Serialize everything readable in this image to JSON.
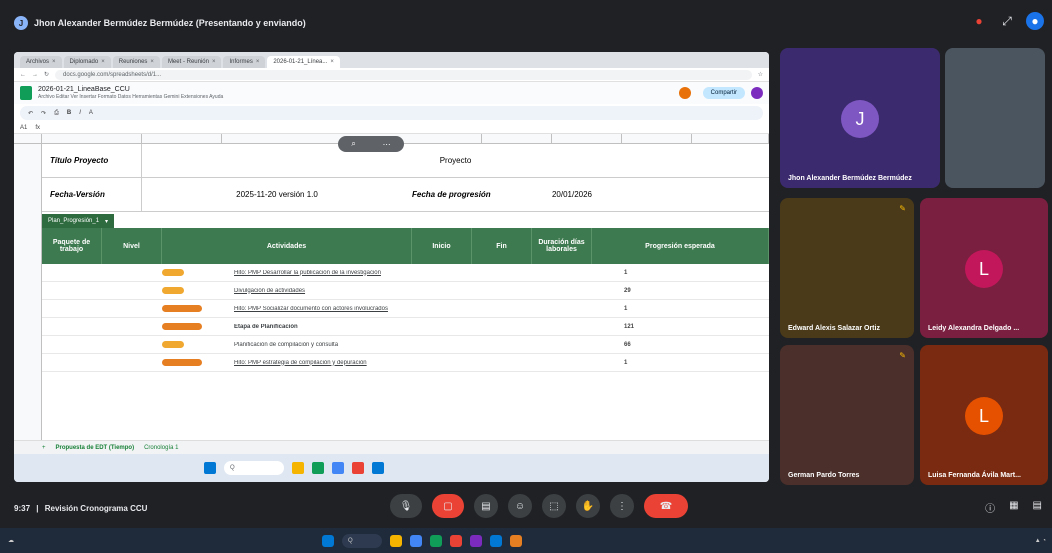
{
  "meet": {
    "presenter_banner": "Jhon Alexander Bermúdez Bermúdez (Presentando y enviando)",
    "meeting_time": "9:37",
    "meeting_name": "Revisión Cronograma CCU"
  },
  "browser": {
    "tabs": [
      "Archivos",
      "Diplomado",
      "Reuniones",
      "Meet - Reunión",
      "Informes",
      "2026-01-21_Línea..."
    ],
    "url": "docs.google.com/spreadsheets/d/1..."
  },
  "sheet": {
    "doc_title": "2026-01-21_LineaBase_CCU",
    "menu": "Archivo  Editar  Ver  Insertar  Formato  Datos  Herramientas  Gemini  Extensiones  Ayuda",
    "share_label": "Compartir",
    "cell_ref": "A1",
    "titulo_label": "Título Proyecto",
    "titulo_value": "Proyecto",
    "fecha_label": "Fecha-Versión",
    "fecha_value": "2025-11-20 versión 1.0",
    "prog_label": "Fecha de progresión",
    "prog_value": "20/01/2026",
    "active_tab": "Plan_Progresión_1",
    "headers": [
      "Paquete de trabajo",
      "Nivel",
      "Actividades",
      "Inicio",
      "Fin",
      "Duración días laborales",
      "Progresión esperada"
    ],
    "rows": [
      {
        "activity": "Hito: PMP Desarrollar la publicación de la investigación",
        "bold": false,
        "dur": "1"
      },
      {
        "activity": "Divulgación de actividades",
        "bold": false,
        "dur": "29"
      },
      {
        "activity": "Hito: PMP Socializar documento con actores involucrados",
        "bold": false,
        "dur": "1"
      },
      {
        "activity": "Etapa de Planificación",
        "bold": true,
        "dur": "121"
      },
      {
        "activity": "Planificación de compilación y consulta",
        "bold": false,
        "dur": "66"
      },
      {
        "activity": "Hito: PMP estrategia de compilación y depuración",
        "bold": false,
        "dur": "1"
      }
    ],
    "bottom_tabs": [
      "Propuesta de EDT (Tiempo)",
      "Cronología 1"
    ]
  },
  "participants": [
    {
      "name": "Jhon Alexander Bermúdez Bermúdez",
      "initial": "J",
      "color": "#5c3fa8"
    },
    {
      "name": "Edward Alexis Salazar Ortiz",
      "initial": "",
      "color": "#4a3a1a"
    },
    {
      "name": "Leidy Alexandra Delgado ...",
      "initial": "L",
      "color": "#c2185b"
    },
    {
      "name": "German Pardo Torres",
      "initial": "",
      "color": "#4a2f2a"
    },
    {
      "name": "Luisa Fernanda Ávila Mart...",
      "initial": "L",
      "color": "#d84315"
    }
  ]
}
